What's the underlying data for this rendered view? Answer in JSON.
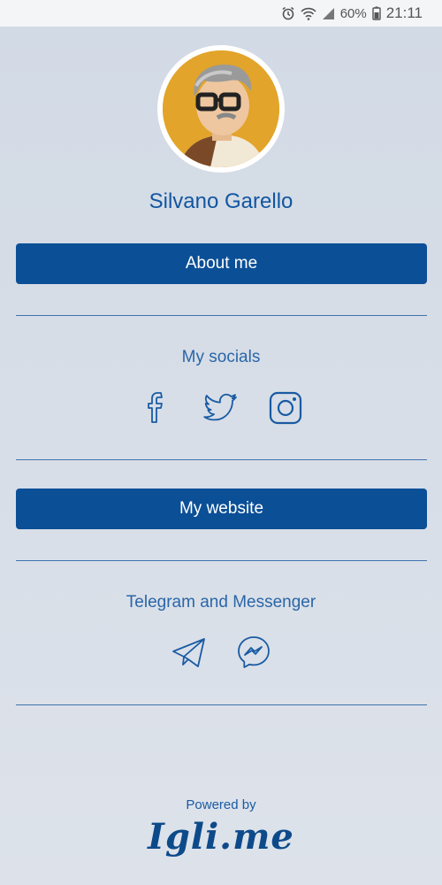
{
  "status_bar": {
    "battery": "60%",
    "time": "21:11"
  },
  "profile": {
    "name": "Silvano Garello"
  },
  "buttons": {
    "about": "About me",
    "website": "My website"
  },
  "socials": {
    "title": "My socials",
    "icons": [
      "facebook-icon",
      "twitter-icon",
      "instagram-icon"
    ]
  },
  "messaging": {
    "title": "Telegram and Messenger",
    "icons": [
      "telegram-icon",
      "messenger-icon"
    ]
  },
  "footer": {
    "powered_by": "Powered by",
    "brand": "Igli.me"
  },
  "colors": {
    "primary": "#0b4f96",
    "background": "#d2dae5"
  }
}
